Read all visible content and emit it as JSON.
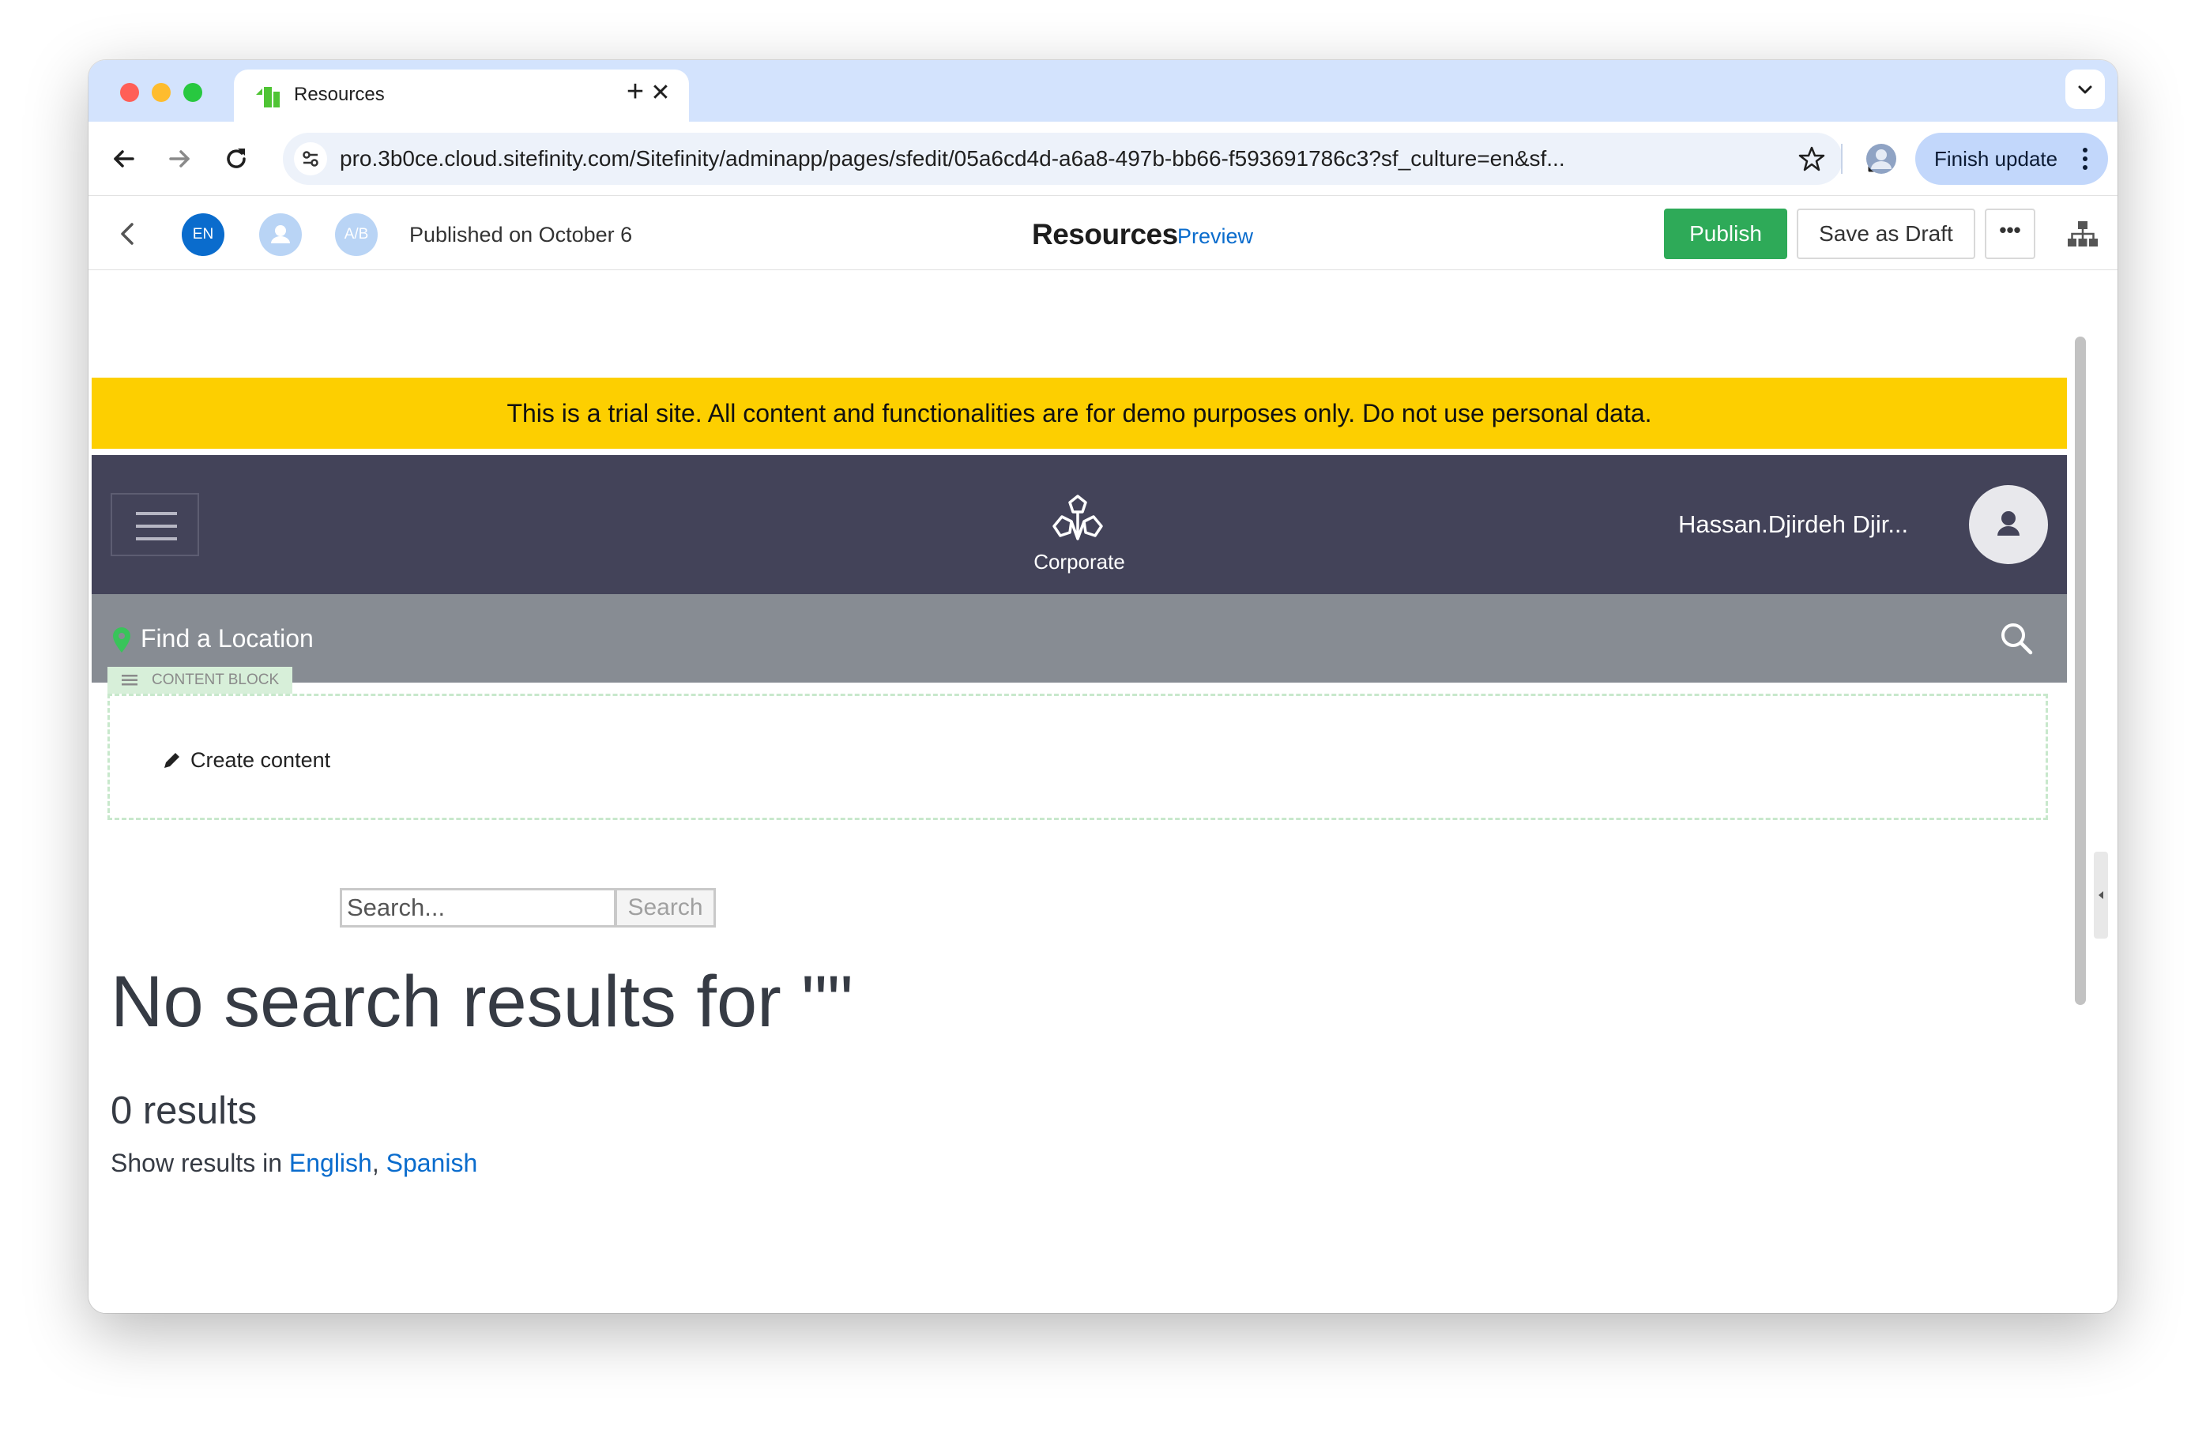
{
  "browser": {
    "tab_title": "Resources",
    "new_tab_symbol": "+",
    "close_symbol": "✕",
    "url": "pro.3b0ce.cloud.sitefinity.com/Sitefinity/adminapp/pages/sfedit/05a6cd4d-a6a8-497b-bb66-f593691786c3?sf_culture=en&sf...",
    "finish_update_label": "Finish update"
  },
  "editor": {
    "language_badge": "EN",
    "ab_badge": "A/B",
    "published_text": "Published on October 6",
    "page_title": "Resources",
    "preview_label": "Preview",
    "publish_label": "Publish",
    "save_draft_label": "Save as Draft",
    "more_label": "•••"
  },
  "site": {
    "trial_banner": "This is a trial site. All content and functionalities are for demo purposes only. Do not use personal data.",
    "logo_text": "Corporate",
    "user_name": "Hassan.Djirdeh Djir...",
    "find_location": "Find a Location",
    "content_block_tag": "CONTENT BLOCK",
    "create_content": "Create content",
    "search_placeholder": "Search...",
    "search_button": "Search",
    "no_results_heading": "No search results for \"\"",
    "results_count": "0 results",
    "show_results_prefix": "Show results in ",
    "lang_english": "English",
    "lang_separator": ", ",
    "lang_spanish": "Spanish"
  },
  "colors": {
    "tabstrip": "#d3e3fd",
    "publish_green": "#2eaa58",
    "trial_banner_yellow": "#fdcf00",
    "site_header": "#434359",
    "location_bar": "#878c93",
    "link_blue": "#0a6ccd"
  },
  "icons": [
    "sitefinity-favicon",
    "back-arrow-icon",
    "forward-arrow-icon",
    "reload-icon",
    "site-settings-icon",
    "bookmark-star-icon",
    "extensions-icon",
    "profile-icon",
    "kebab-menu-icon",
    "chevron-left-icon",
    "user-icon",
    "sitemap-icon",
    "hamburger-icon",
    "logo-icon",
    "map-pin-icon",
    "search-icon",
    "pencil-icon"
  ]
}
